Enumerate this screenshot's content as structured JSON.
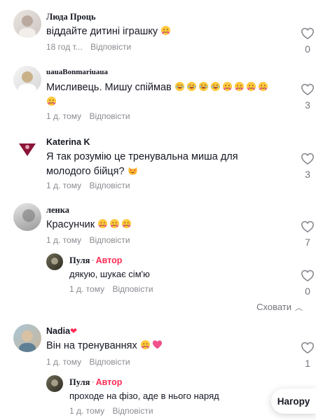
{
  "reply_label": "Відповісти",
  "comments": [
    {
      "author": "Люда Проць",
      "text": "віддайте дитині іграшку",
      "emojis": [
        "hug"
      ],
      "time": "18 год т...",
      "likes": "0"
    },
    {
      "author": "uauaBonmariuaua",
      "text": "Мисливець. Мишу спіймав",
      "emojis": [
        "laugh",
        "laugh",
        "laugh",
        "laugh",
        "hug",
        "hug",
        "hug",
        "hug",
        "hug"
      ],
      "time": "1 д. тому",
      "likes": "3"
    },
    {
      "author": "Katerina K",
      "text": "Я так розумію це тренувальна миша для молодого бійця?",
      "emojis": [
        "heart-eyes-cat"
      ],
      "time": "1 д. тому",
      "likes": "3"
    },
    {
      "author": "ленка",
      "text": "Красунчик",
      "emojis": [
        "hug",
        "hug",
        "hug"
      ],
      "time": "1 д. тому",
      "likes": "7"
    },
    {
      "author": "Пуля",
      "author_badge": "Автор",
      "text": "дякую, шукає сім'ю",
      "time": "1 д. тому",
      "likes": "0"
    },
    {
      "author": "Nadia",
      "author_suffix_icon": "red-heart",
      "text": "Він на тренуваннях",
      "emojis": [
        "hug",
        "pink-heart"
      ],
      "time": "1 д. тому",
      "likes": "1"
    },
    {
      "author": "Пуля",
      "author_badge": "Автор",
      "text": "проходе на фізо, аде в нього наряд",
      "time": "1 д. тому",
      "likes": ""
    }
  ],
  "hide_label": "Сховати",
  "top_button_label": "Нагору",
  "icons": {
    "like": "heart-outline-icon",
    "hide_chevron": "chevron-up-icon"
  },
  "colors": {
    "author_badge": "#fe2c55",
    "meta": "#8a8b91"
  }
}
